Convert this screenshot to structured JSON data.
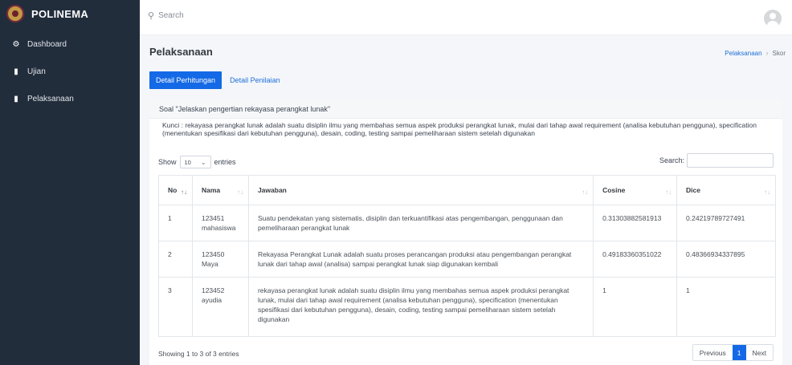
{
  "sidebar": {
    "brand": "POLINEMA",
    "items": [
      {
        "label": "Dashboard",
        "icon": "dashboard-icon"
      },
      {
        "label": "Ujian",
        "icon": "file-icon"
      },
      {
        "label": "Pelaksanaan",
        "icon": "file-icon"
      }
    ]
  },
  "topbar": {
    "search_placeholder": "Search"
  },
  "page": {
    "title": "Pelaksanaan",
    "breadcrumb": [
      "Pelaksanaan",
      "Skor"
    ]
  },
  "tabs": [
    {
      "label": "Detail Perhitungan",
      "active": true
    },
    {
      "label": "Detail Penilaian",
      "active": false
    }
  ],
  "card": {
    "soal": "Soal \"Jelaskan pengertian rekayasa perangkat lunak\"",
    "kunci": "Kunci : rekayasa perangkat lunak adalah suatu disiplin ilmu yang membahas semua aspek produksi perangkat lunak, mulai dari tahap awal requirement (analisa kebutuhan pengguna), specification (menentukan spesifikasi dari kebutuhan pengguna), desain, coding, testing sampai pemeliharaan sistem setelah digunakan",
    "show_label": "Show",
    "entries_value": "10",
    "entries_label": "entries",
    "search_label": "Search:"
  },
  "table": {
    "headers": [
      "No",
      "Nama",
      "Jawaban",
      "Cosine",
      "Dice"
    ],
    "rows": [
      {
        "no": "1",
        "nim": "123451",
        "nama": "mahasiswa",
        "jawaban": "Suatu pendekatan yang sistematis, disiplin dan terkuantifikasi atas pengembangan, penggunaan dan pemeliharaan perangkat lunak",
        "cosine": "0.31303882581913",
        "dice": "0.24219789727491"
      },
      {
        "no": "2",
        "nim": "123450",
        "nama": "Maya",
        "jawaban": "Rekayasa Perangkat Lunak adalah suatu proses perancangan produksi atau pengembangan perangkat lunak dari tahap awal (analisa) sampai perangkat lunak siap digunakan kembali",
        "cosine": "0.49183360351022",
        "dice": "0.48366934337895"
      },
      {
        "no": "3",
        "nim": "123452",
        "nama": "ayudia",
        "jawaban": "rekayasa perangkat lunak adalah suatu disiplin ilmu yang membahas semua aspek produksi perangkat lunak, mulai dari tahap awal requirement (analisa kebutuhan pengguna), specification (menentukan spesifikasi dari kebutuhan pengguna), desain, coding, testing sampai pemeliharaan sistem setelah digunakan",
        "cosine": "1",
        "dice": "1"
      }
    ]
  },
  "footer": {
    "info": "Showing 1 to 3 of 3 entries",
    "prev": "Previous",
    "page": "1",
    "next": "Next"
  },
  "colors": {
    "sidebar": "#222d3c",
    "accent": "#1469e6"
  }
}
